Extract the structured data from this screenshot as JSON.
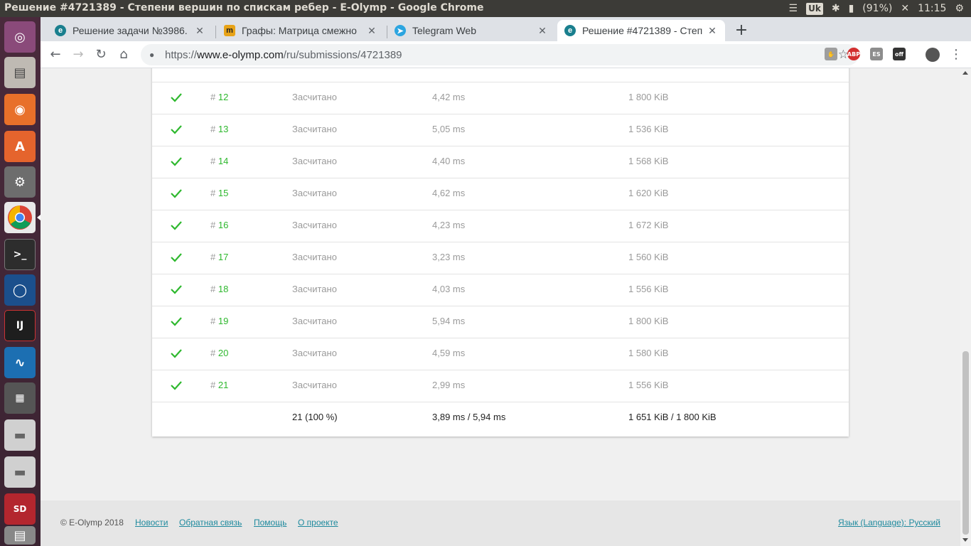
{
  "window": {
    "title": "Решение #4721389 - Степени вершин по спискам ребер - E-Olymp - Google Chrome"
  },
  "tray": {
    "keyboard": "Uk",
    "battery": "(91%)",
    "time": "11:15"
  },
  "tabs": [
    {
      "label": "Решение задачи №3986. ",
      "favicon": "e-olymp-icon",
      "color": "#1a7f8e"
    },
    {
      "label": "Графы: Матрица смежно",
      "favicon": "mathprofi-icon",
      "color": "#e8a317"
    },
    {
      "label": "Telegram Web",
      "favicon": "telegram-icon",
      "color": "#2ca5e0"
    },
    {
      "label": "Решение #4721389 - Степ",
      "favicon": "e-olymp-icon",
      "color": "#1a7f8e"
    }
  ],
  "omnibox": {
    "scheme": "https://",
    "host": "www.e-olymp.com",
    "path": "/ru/submissions/4721389"
  },
  "tests": [
    {
      "hash": "#",
      "num": "12",
      "status": "Засчитано",
      "time": "4,42 ms",
      "mem": "1 800 KiB"
    },
    {
      "hash": "#",
      "num": "13",
      "status": "Засчитано",
      "time": "5,05 ms",
      "mem": "1 536 KiB"
    },
    {
      "hash": "#",
      "num": "14",
      "status": "Засчитано",
      "time": "4,40 ms",
      "mem": "1 568 KiB"
    },
    {
      "hash": "#",
      "num": "15",
      "status": "Засчитано",
      "time": "4,62 ms",
      "mem": "1 620 KiB"
    },
    {
      "hash": "#",
      "num": "16",
      "status": "Засчитано",
      "time": "4,23 ms",
      "mem": "1 672 KiB"
    },
    {
      "hash": "#",
      "num": "17",
      "status": "Засчитано",
      "time": "3,23 ms",
      "mem": "1 560 KiB"
    },
    {
      "hash": "#",
      "num": "18",
      "status": "Засчитано",
      "time": "4,03 ms",
      "mem": "1 556 KiB"
    },
    {
      "hash": "#",
      "num": "19",
      "status": "Засчитано",
      "time": "5,94 ms",
      "mem": "1 800 KiB"
    },
    {
      "hash": "#",
      "num": "20",
      "status": "Засчитано",
      "time": "4,59 ms",
      "mem": "1 580 KiB"
    },
    {
      "hash": "#",
      "num": "21",
      "status": "Засчитано",
      "time": "2,99 ms",
      "mem": "1 556 KiB"
    }
  ],
  "summary": {
    "passed": "21 (100 %)",
    "time": "3,89 ms / 5,94 ms",
    "mem": "1 651 KiB / 1 800 KiB"
  },
  "footer": {
    "copyright": "© E-Olymp 2018",
    "news": "Новости",
    "feedback": "Обратная связь",
    "help": "Помощь",
    "about": "О проекте",
    "language": "Язык (Language): Русский"
  },
  "colors": {
    "accent_green": "#2eb82e",
    "link": "#1f8a9e"
  }
}
